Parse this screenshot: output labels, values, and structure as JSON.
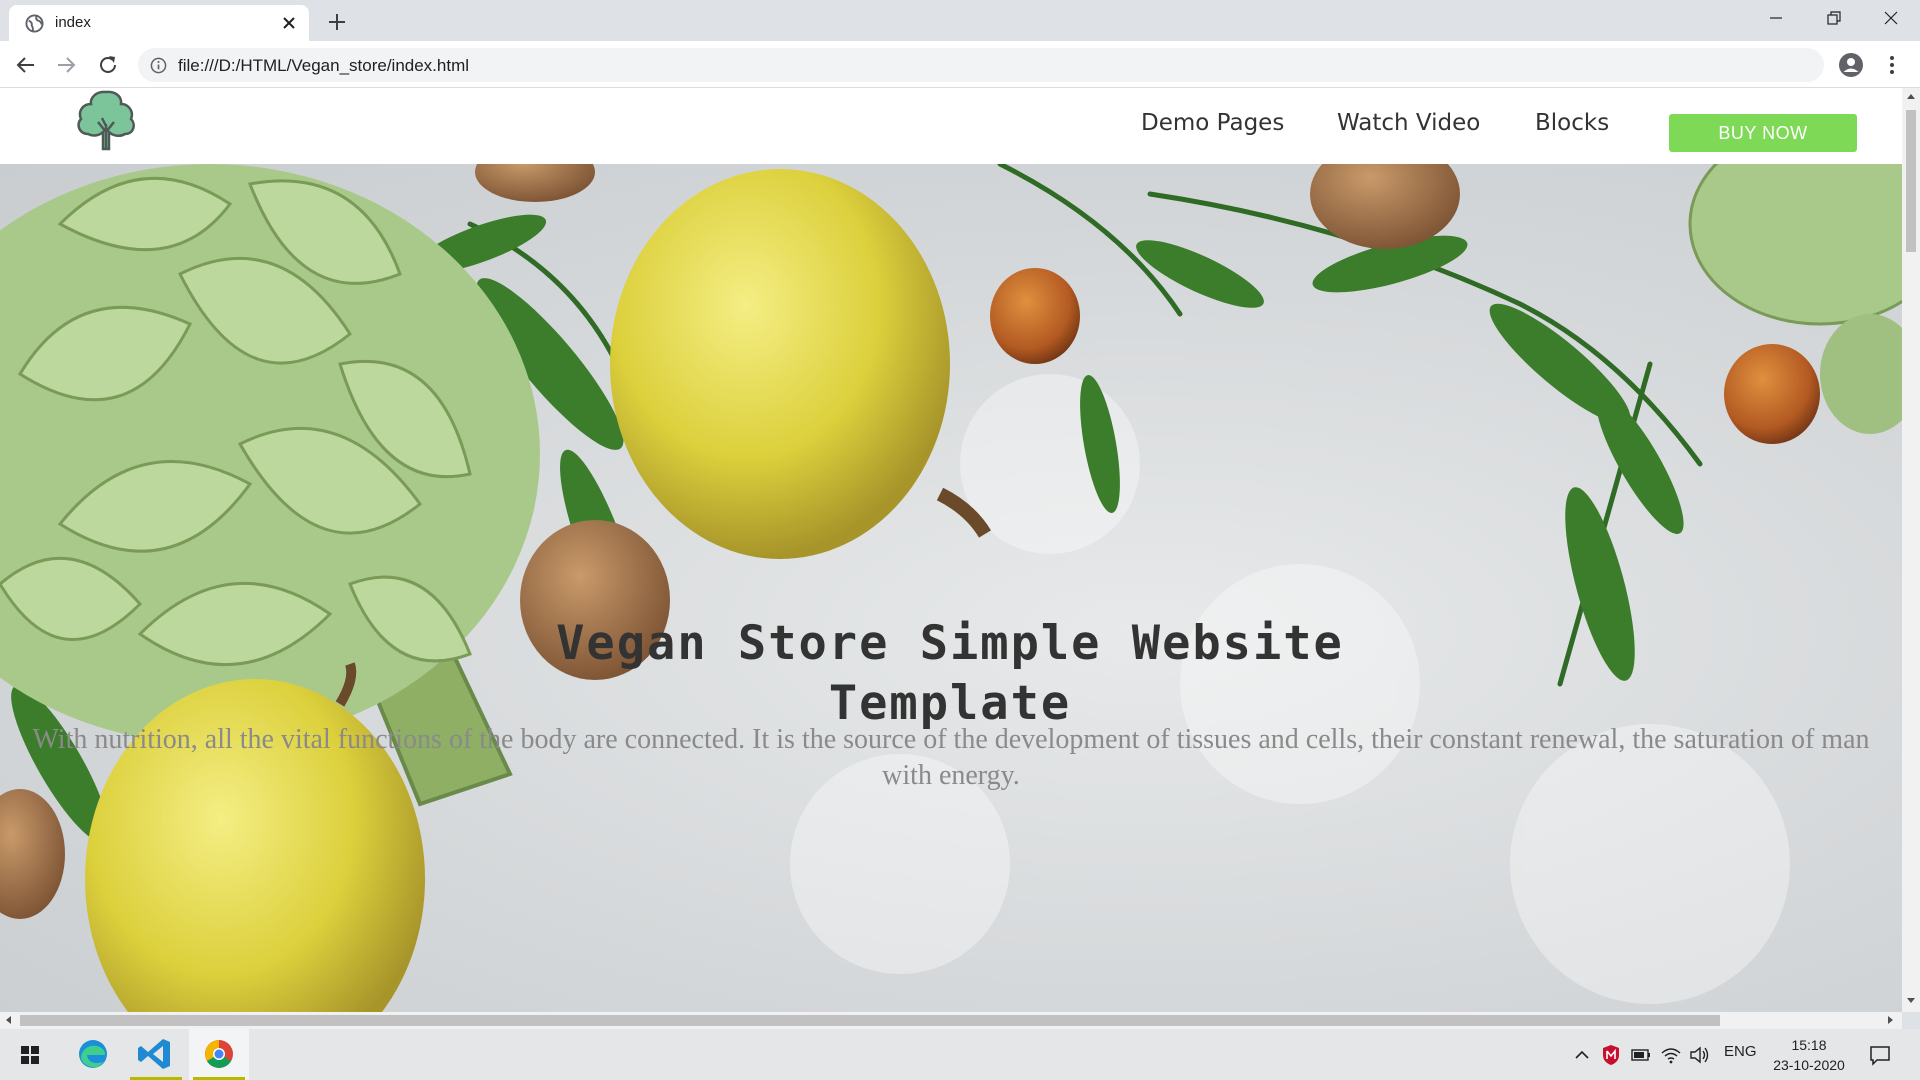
{
  "browser": {
    "tab_title": "index",
    "url": "file:///D:/HTML/Vegan_store/index.html"
  },
  "site": {
    "nav": [
      {
        "label": "Demo Pages"
      },
      {
        "label": "Watch Video"
      },
      {
        "label": "Blocks"
      }
    ],
    "buy_button": "BUY NOW"
  },
  "hero": {
    "title": "Vegan Store Simple Website Template",
    "subtitle": "With nutrition, all the vital functions of the body are connected. It is the source of the development of tissues and cells, their constant renewal, the saturation of man with energy."
  },
  "taskbar": {
    "apps": [
      "windows-start",
      "edge",
      "vscode",
      "chrome"
    ],
    "language": "ENG",
    "time": "15:18",
    "date": "23-10-2020"
  },
  "colors": {
    "accent": "#7ed957",
    "logo_green": "#5aa878"
  }
}
